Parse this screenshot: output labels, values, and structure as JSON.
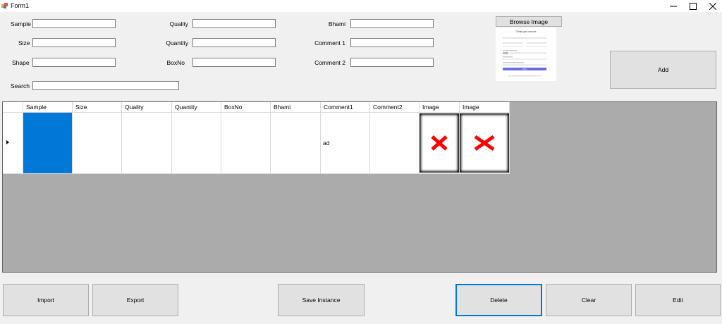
{
  "window": {
    "title": "Form1"
  },
  "form": {
    "sample_label": "Sample",
    "size_label": "Size",
    "shape_label": "Shape",
    "search_label": "Search",
    "quality_label": "Quality",
    "quantity_label": "Quantity",
    "boxno_label": "BoxNo",
    "bhami_label": "Bhami",
    "comment1_label": "Comment 1",
    "comment2_label": "Comment 2",
    "sample_value": "",
    "size_value": "",
    "shape_value": "",
    "search_value": "",
    "quality_value": "",
    "quantity_value": "",
    "boxno_value": "",
    "bhami_value": "",
    "comment1_value": "",
    "comment2_value": ""
  },
  "browse_button": "Browse Image",
  "preview": {
    "heading": "Create your account",
    "button": "Next"
  },
  "add_button": "Add",
  "grid": {
    "columns": [
      "Sample",
      "Size",
      "Quality",
      "Quantity",
      "BoxNo",
      "Bhami",
      "Comment1",
      "Comment2",
      "Image",
      "Image"
    ],
    "rows": [
      {
        "cells": [
          "",
          "",
          "",
          "",
          "",
          "",
          "ad",
          ""
        ],
        "images": [
          "broken-image-icon",
          "broken-image-icon"
        ]
      }
    ]
  },
  "buttons": {
    "import": "Import",
    "export": "Export",
    "save_instance": "Save Instance",
    "delete": "Delete",
    "clear": "Clear",
    "edit": "Edit"
  },
  "colors": {
    "selection": "#0078d7",
    "grid_background": "#ababab",
    "error_x": "#ff0000"
  }
}
